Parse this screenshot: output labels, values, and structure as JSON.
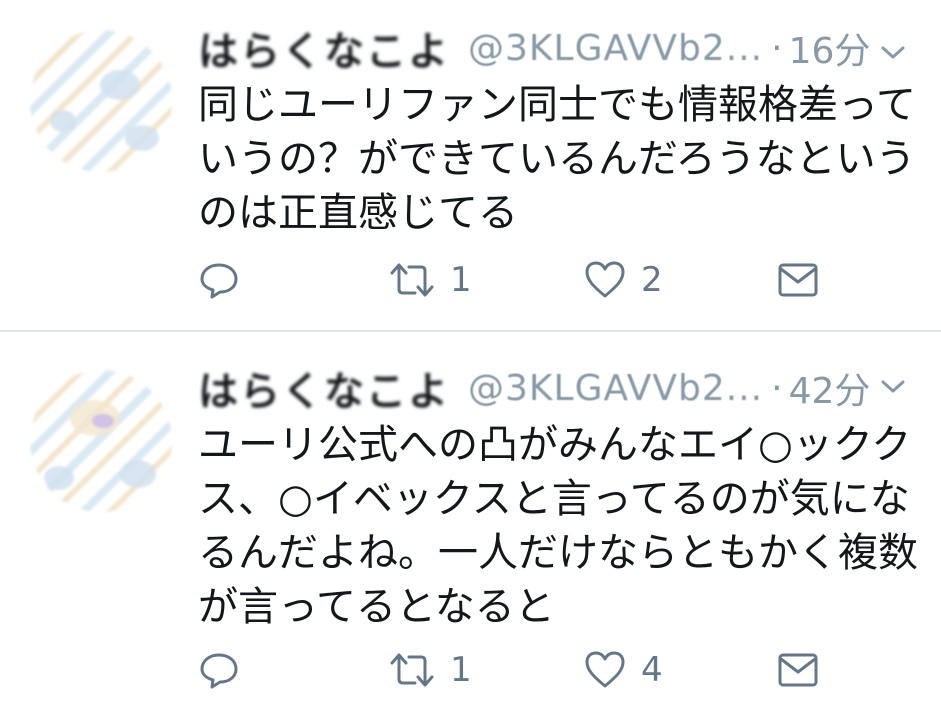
{
  "tweets": [
    {
      "display_name": "はらくなこよ",
      "handle": "@3KLGAVVb2...",
      "dot": "·",
      "time": "16分",
      "text_lines": [
        "同じユーリファン同士でも情報格差って",
        "いうの？ができているんだろうなという",
        "のは正直感じてる"
      ],
      "retweet_count": "1",
      "like_count": "2"
    },
    {
      "display_name": "はらくなこよ",
      "handle": "@3KLGAVVb2...",
      "dot": "·",
      "time": "42分",
      "text_lines": [
        "ユーリ公式への凸がみんなエイ○ックク",
        "ス、○イベックスと言ってるのが気にな",
        "るんだよね。一人だけならともかく複数",
        "が言ってるとなると"
      ],
      "retweet_count": "1",
      "like_count": "4"
    }
  ],
  "icons": {
    "reply": "reply-icon",
    "retweet": "retweet-icon",
    "like": "heart-icon",
    "dm": "mail-icon",
    "menu": "chevron-down-icon"
  },
  "colors": {
    "text": "#14171a",
    "muted": "#8899a6",
    "icon": "#657786",
    "divider": "#dfe3e6"
  }
}
